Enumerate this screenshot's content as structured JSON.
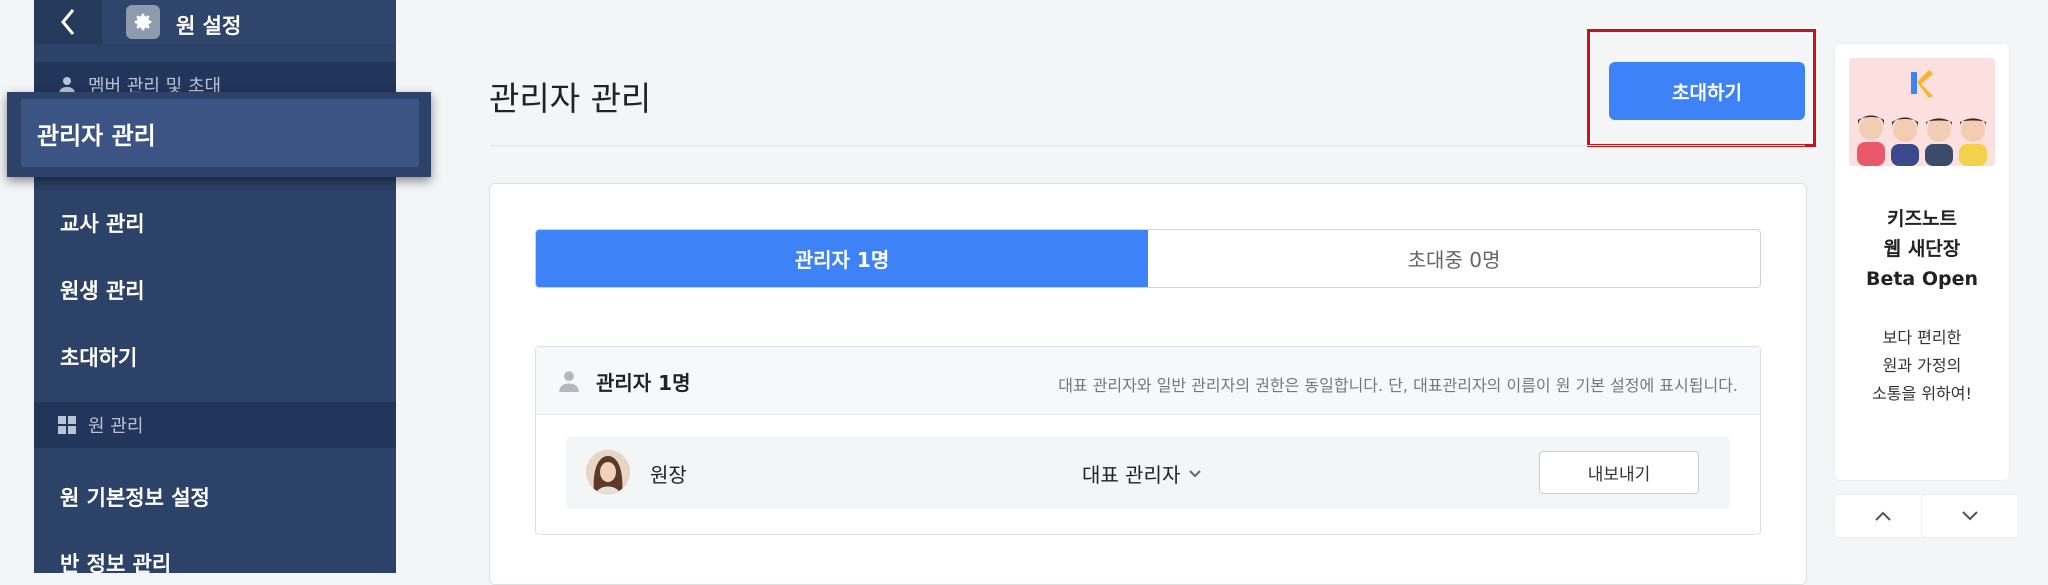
{
  "sidebar": {
    "title": "원 설정",
    "section_members": "멤버 관리 및 초대",
    "highlighted_item": "관리자 관리",
    "items_members": [
      "교사 관리",
      "원생 관리",
      "초대하기"
    ],
    "section_org": "원 관리",
    "items_org": [
      "원 기본정보 설정",
      "반 정보 관리"
    ]
  },
  "main": {
    "page_title": "관리자 관리",
    "invite_button": "초대하기",
    "tabs": [
      {
        "label": "관리자 1명",
        "active": true
      },
      {
        "label": "초대중 0명",
        "active": false
      }
    ],
    "admin_section": {
      "count_label": "관리자 1명",
      "note": "대표 관리자와 일반 관리자의 권한은 동일합니다. 단, 대표관리자의 이름이 원 기본 설정에 표시됩니다.",
      "admins": [
        {
          "name": "원장",
          "role": "대표 관리자",
          "action": "내보내기"
        }
      ]
    }
  },
  "banner": {
    "title_line1": "키즈노트",
    "title_line2": "웹 새단장",
    "title_line3": "Beta Open",
    "desc_line1": "보다 편리한",
    "desc_line2": "원과 가정의",
    "desc_line3": "소통을 위하여!"
  },
  "colors": {
    "sidebar_bg": "#2d4268",
    "accent_blue": "#3d82f6",
    "highlight_red": "#c2141b"
  },
  "icons": [
    "back-chevron-icon",
    "gear-icon",
    "person-icon",
    "grid-icon",
    "chevron-down-icon",
    "chevron-up-icon"
  ]
}
